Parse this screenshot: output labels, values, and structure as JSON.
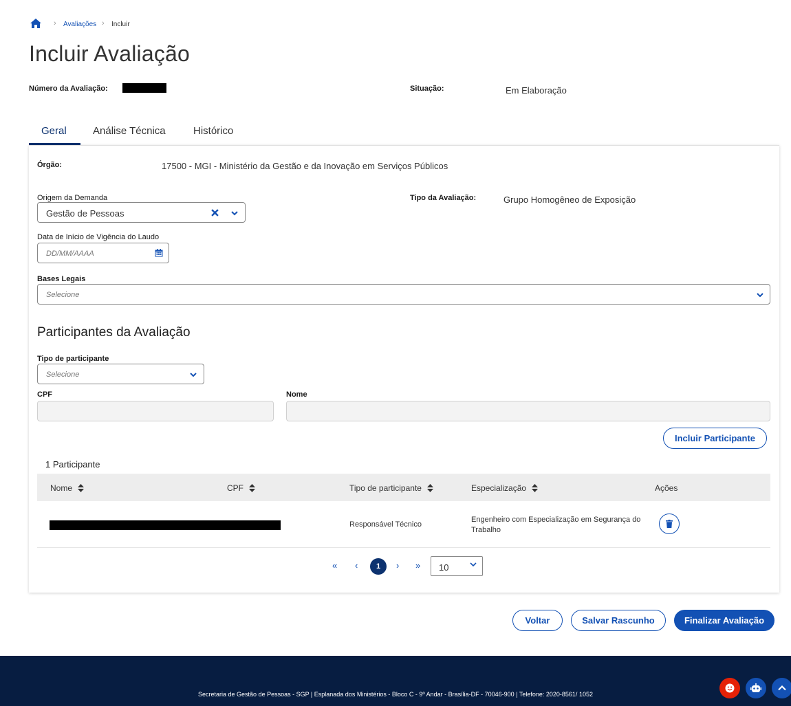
{
  "breadcrumb": {
    "items": [
      "Avaliações",
      "Incluir"
    ]
  },
  "page": {
    "title": "Incluir Avaliação"
  },
  "summary": {
    "numero_label": "Número da Avaliação:",
    "situacao_label": "Situação:",
    "situacao_value": "Em Elaboração"
  },
  "tabs": [
    {
      "label": "Geral",
      "active": true
    },
    {
      "label": "Análise Técnica",
      "active": false
    },
    {
      "label": "Histórico",
      "active": false
    }
  ],
  "form": {
    "orgao_label": "Órgão:",
    "orgao_value": "17500 - MGI - Ministério da Gestão e da Inovação em Serviços Públicos",
    "origem_label": "Origem da Demanda",
    "origem_value": "Gestão de Pessoas",
    "tipo_label": "Tipo da Avaliação:",
    "tipo_value": "Grupo Homogêneo de Exposição",
    "data_label": "Data de Início de Vigência do Laudo",
    "data_placeholder": "DD/MM/AAAA",
    "bases_label": "Bases Legais",
    "bases_placeholder": "Selecione"
  },
  "participantes": {
    "section_title": "Participantes da Avaliação",
    "tipo_label": "Tipo de participante",
    "tipo_placeholder": "Selecione",
    "cpf_label": "CPF",
    "nome_label": "Nome",
    "incluir_button": "Incluir Participante",
    "count_label": "1 Participante",
    "columns": [
      "Nome",
      "CPF",
      "Tipo de participante",
      "Especialização",
      "Ações"
    ],
    "rows": [
      {
        "tipo": "Responsável Técnico",
        "especializacao": "Engenheiro com Especialização em Segurança do Trabalho"
      }
    ],
    "pagination": {
      "current_page": "1",
      "page_size": "10"
    }
  },
  "actions": {
    "voltar": "Voltar",
    "salvar": "Salvar Rascunho",
    "finalizar": "Finalizar Avaliação"
  },
  "footer": {
    "text": "Secretaria de Gestão de Pessoas - SGP | Esplanada dos Ministérios - Bloco C - 9º Andar - Brasília-DF - 70046-900 | Telefone: 2020-8561/ 1052"
  },
  "colors": {
    "primary": "#1351b4",
    "dark_blue": "#0c326f",
    "footer_bg": "#071d41",
    "fab_red": "#e52207"
  },
  "icons": [
    "home-icon",
    "chevron-right-icon",
    "clear-x-icon",
    "chevron-down-icon",
    "calendar-icon",
    "sort-icon",
    "trash-icon",
    "double-chevron-left-icon",
    "chevron-left-icon",
    "chevron-right-icon",
    "double-chevron-right-icon",
    "smiley-icon",
    "robot-icon",
    "chevron-up-icon"
  ]
}
